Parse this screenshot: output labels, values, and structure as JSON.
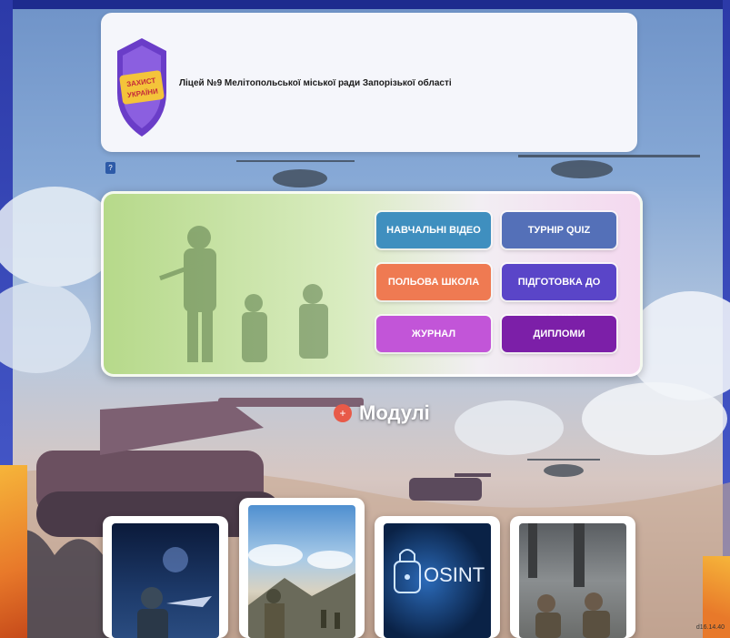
{
  "header": {
    "school_name": "Ліцей №9 Мелітопольської міської ради Запорізької області",
    "logo_text": "ЗАХИСТ УКРАЇНИ"
  },
  "badge": "?",
  "menu": {
    "buttons": [
      {
        "label": "НАВЧАЛЬНІ ВІДЕО",
        "color": "#3f8fbf"
      },
      {
        "label": "ТУРНІР QUIZ",
        "color": "#5470b8"
      },
      {
        "label": "ПОЛЬОВА ШКОЛА",
        "color": "#ef7a52"
      },
      {
        "label": "ПІДГОТОВКА ДО ТУРНІРУ",
        "color": "#5a45c8"
      },
      {
        "label": "ЖУРНАЛ",
        "color": "#c255d8"
      },
      {
        "label": "ДИПЛОМИ",
        "color": "#7c1fa8"
      }
    ]
  },
  "modules": {
    "title": "Модулі",
    "cards": [
      {
        "label": "",
        "theme": "night-soldier"
      },
      {
        "label": "",
        "theme": "mountain-soldiers"
      },
      {
        "label": "OSINT",
        "theme": "osint"
      },
      {
        "label": "",
        "theme": "combat"
      }
    ]
  },
  "timestamp": "d16.14.40"
}
